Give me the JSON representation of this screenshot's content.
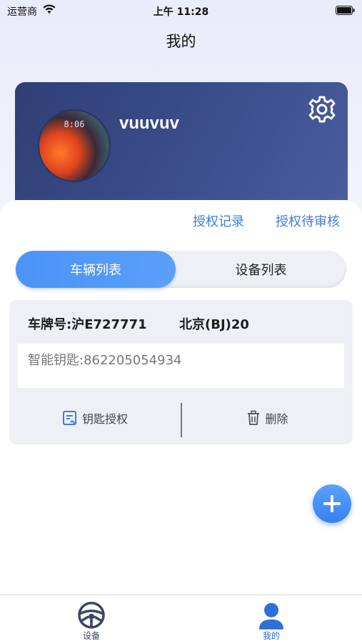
{
  "status_bar": {
    "carrier": "运营商",
    "time": "上午 11:28"
  },
  "header": {
    "title": "我的"
  },
  "profile": {
    "username": "vuuvuv",
    "avatar_time": "8:06"
  },
  "links": {
    "auth_record": "授权记录",
    "auth_pending": "授权待审核"
  },
  "segments": {
    "active": "车辆列表",
    "inactive": "设备列表"
  },
  "vehicle": {
    "plate": "车牌号:沪E727771",
    "model": "北京(BJ)20",
    "smart_key": "智能钥匙:862205054934",
    "key_auth_label": "钥匙授权",
    "delete_label": "删除"
  },
  "tabbar": {
    "items": [
      {
        "label": "设备",
        "color": "#3d4560"
      },
      {
        "label": "我的",
        "color": "#2e6fd8"
      }
    ]
  },
  "colors": {
    "accent": "#3e7ce3",
    "card": "#3a4d8a"
  }
}
